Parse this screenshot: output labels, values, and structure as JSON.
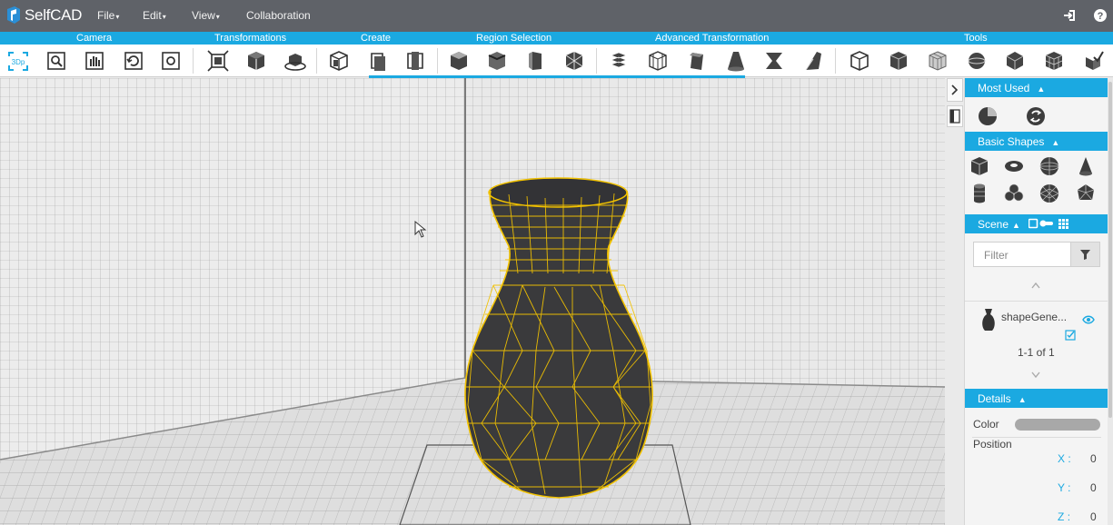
{
  "app": {
    "brand": "SelfCAD",
    "menus": [
      {
        "label": "File",
        "has_caret": true
      },
      {
        "label": "Edit",
        "has_caret": true
      },
      {
        "label": "View",
        "has_caret": true
      },
      {
        "label": "Collaboration",
        "has_caret": false
      }
    ],
    "caret": "▾",
    "right_icons": [
      "login-icon",
      "help-icon"
    ]
  },
  "toolbar": {
    "groups": [
      "Camera",
      "Transformations",
      "Create",
      "Region Selection",
      "Advanced Transformation",
      "Tools"
    ],
    "camera_tools": [
      "3d-view-icon",
      "zoom-fit-icon",
      "pan-hand-icon",
      "reset-camera-icon",
      "screenshot-icon"
    ],
    "transformation_tools": [
      "move-box-icon",
      "rotate-cube-icon",
      "scale-cube-icon"
    ],
    "create_tools": [
      "box-create-icon",
      "extrude-icon",
      "inset-icon"
    ],
    "region_tools": [
      "select-face-icon",
      "select-edge-icon",
      "select-vertex-icon",
      "select-region-icon"
    ],
    "advanced_tools": [
      "boolean-icon",
      "bevel-icon",
      "twist-icon",
      "taper-icon",
      "bend-icon",
      "cut-icon"
    ],
    "tools": [
      "stitch-icon",
      "solid-cube-icon",
      "mesh-cube-icon",
      "sphere-tool-icon",
      "hollow-icon",
      "grid-cube-icon",
      "magic-icon"
    ],
    "viewport_label": "3Dp"
  },
  "panel": {
    "most_used": {
      "title": "Most Used",
      "items": [
        "sketch-icon",
        "rotate-arrow-icon"
      ]
    },
    "basic_shapes": {
      "title": "Basic Shapes",
      "items": [
        "cube-shape-icon",
        "torus-shape-icon",
        "sphere-shape-icon",
        "cone-shape-icon",
        "cylinder-shape-icon",
        "cluster-shape-icon",
        "geosphere-shape-icon",
        "icosahedron-shape-icon"
      ]
    },
    "scene": {
      "title": "Scene",
      "filter_placeholder": "Filter",
      "items": [
        {
          "name": "shapeGene...",
          "visible": true
        }
      ],
      "pagination": "1-1 of 1"
    },
    "details": {
      "title": "Details",
      "color_label": "Color",
      "color_value": "#a8a8a8",
      "position_label": "Position",
      "position": [
        {
          "axis": "X",
          "sep": ":",
          "value": "0"
        },
        {
          "axis": "Y",
          "sep": ":",
          "value": "0"
        },
        {
          "axis": "Z",
          "sep": ":",
          "value": "0"
        }
      ]
    },
    "triangle_up": "▲"
  },
  "colors": {
    "accent": "#1ba9e1",
    "topbar": "#5f6268",
    "wireframe": "#f2c200",
    "model": "#3a3a3c",
    "grid": "#8a8a8a"
  }
}
